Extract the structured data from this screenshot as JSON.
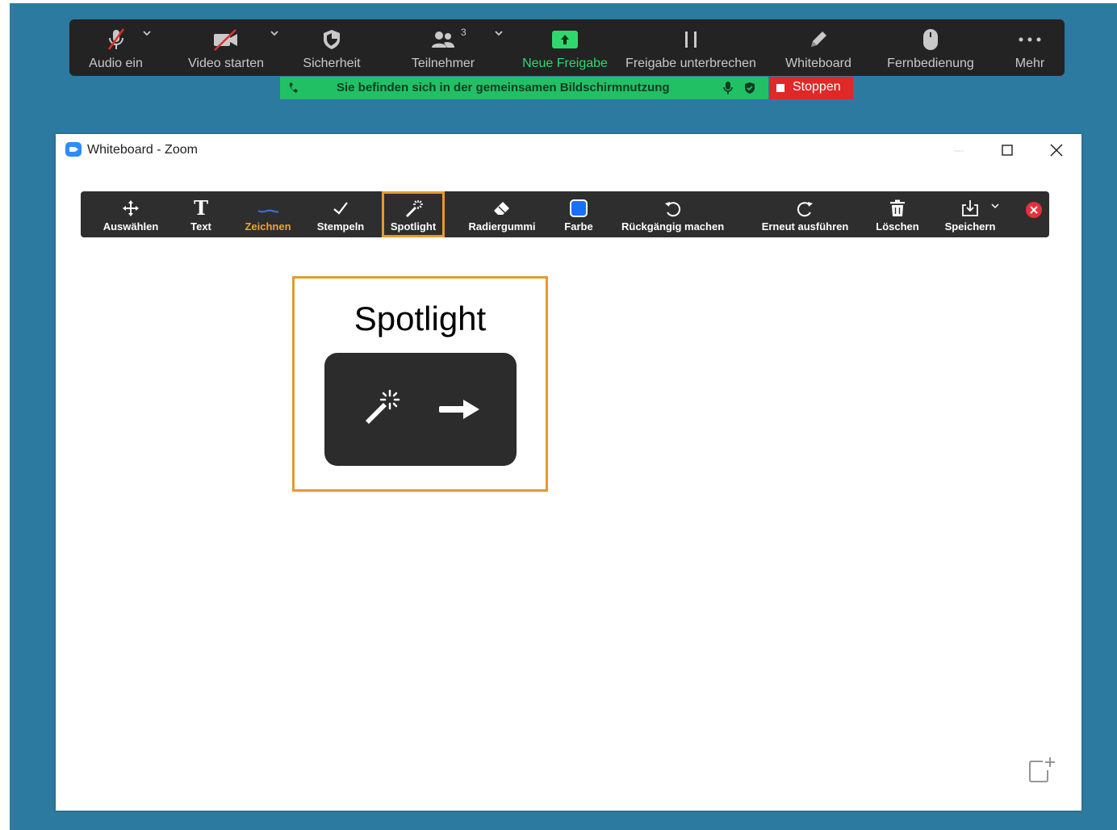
{
  "meeting_bar": {
    "audio": "Audio ein",
    "video": "Video starten",
    "security": "Sicherheit",
    "participants": "Teilnehmer",
    "participants_count": "3",
    "new_share": "Neue Freigabe",
    "pause_share": "Freigabe unterbrechen",
    "whiteboard": "Whiteboard",
    "remote_control": "Fernbedienung",
    "more": "Mehr"
  },
  "share_banner": {
    "text": "Sie befinden sich in der gemeinsamen Bildschirmnutzung",
    "stop": "Stoppen"
  },
  "window": {
    "title": "Whiteboard - Zoom"
  },
  "toolbar": {
    "items": [
      {
        "label": "Auswählen",
        "icon": "move-icon"
      },
      {
        "label": "Text",
        "icon": "text-icon"
      },
      {
        "label": "Zeichnen",
        "icon": "draw-icon"
      },
      {
        "label": "Stempeln",
        "icon": "stamp-check-icon"
      },
      {
        "label": "Spotlight",
        "icon": "magic-wand-icon"
      },
      {
        "label": "Radiergummi",
        "icon": "eraser-icon"
      },
      {
        "label": "Farbe",
        "icon": "color-swatch-icon"
      },
      {
        "label": "Rückgängig machen",
        "icon": "undo-icon"
      },
      {
        "label": "Erneut ausführen",
        "icon": "redo-icon"
      },
      {
        "label": "Löschen",
        "icon": "trash-icon"
      },
      {
        "label": "Speichern",
        "icon": "save-icon"
      }
    ],
    "active_index": 2,
    "highlight_index": 4,
    "color_value": "#1a6fff"
  },
  "callout": {
    "title": "Spotlight"
  },
  "colors": {
    "desktop": "#2d7aa1",
    "meeting_bar": "#232323",
    "share_green": "#22c065",
    "stop_red": "#e02828",
    "highlight_orange": "#e39a32",
    "active_tool": "#f0a52a"
  }
}
